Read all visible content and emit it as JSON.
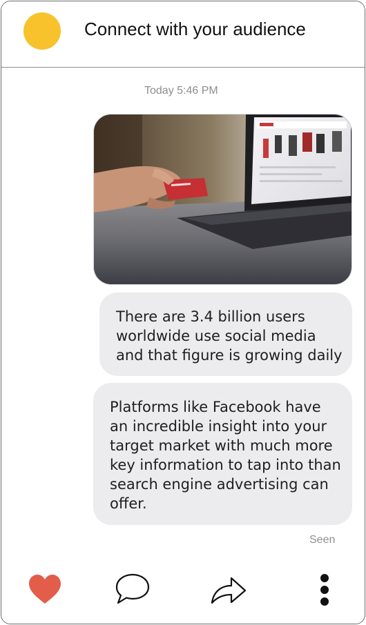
{
  "header": {
    "title": "Connect with your audience",
    "avatar_color": "#F7C22B"
  },
  "conversation": {
    "timestamp": "Today 5:46 PM",
    "image_message": {
      "alt": "Hand holding a credit card in front of a laptop showing an online store"
    },
    "messages": [
      {
        "lines": [
          "There are 3.4 billion users",
          "worldwide use social media",
          "and that figure is growing daily"
        ]
      },
      {
        "lines": [
          "Platforms like Facebook have",
          "an incredible insight into your",
          "target market with much more",
          "key information to tap into than",
          "search engine advertising can",
          "offer."
        ]
      }
    ],
    "status": "Seen"
  },
  "actions": {
    "like_icon": "heart-icon",
    "comment_icon": "speech-bubble-icon",
    "share_icon": "share-arrow-icon",
    "more_icon": "vertical-ellipsis-icon",
    "like_color": "#E35D4B"
  }
}
